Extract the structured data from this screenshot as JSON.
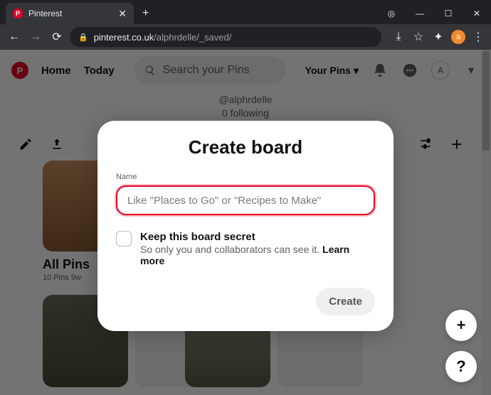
{
  "browser": {
    "tab_title": "Pinterest",
    "tab_favicon_letter": "P",
    "url_domain": "pinterest.co.uk",
    "url_path": "/alphrdelle/_saved/",
    "avatar_letter": "a"
  },
  "header": {
    "home": "Home",
    "today": "Today",
    "search_placeholder": "Search your Pins",
    "your_pins": "Your Pins",
    "avatar_letter": "A"
  },
  "profile": {
    "handle": "@alphrdelle",
    "following": "0 following"
  },
  "board_card": {
    "title": "All Pins",
    "subtitle": "10 Pins   9w"
  },
  "fab": {
    "plus": "+",
    "help": "?"
  },
  "modal": {
    "title": "Create board",
    "name_label": "Name",
    "name_placeholder": "Like \"Places to Go\" or \"Recipes to Make\"",
    "secret_title": "Keep this board secret",
    "secret_sub": "So only you and collaborators can see it. ",
    "learn_more": "Learn more",
    "create": "Create"
  }
}
